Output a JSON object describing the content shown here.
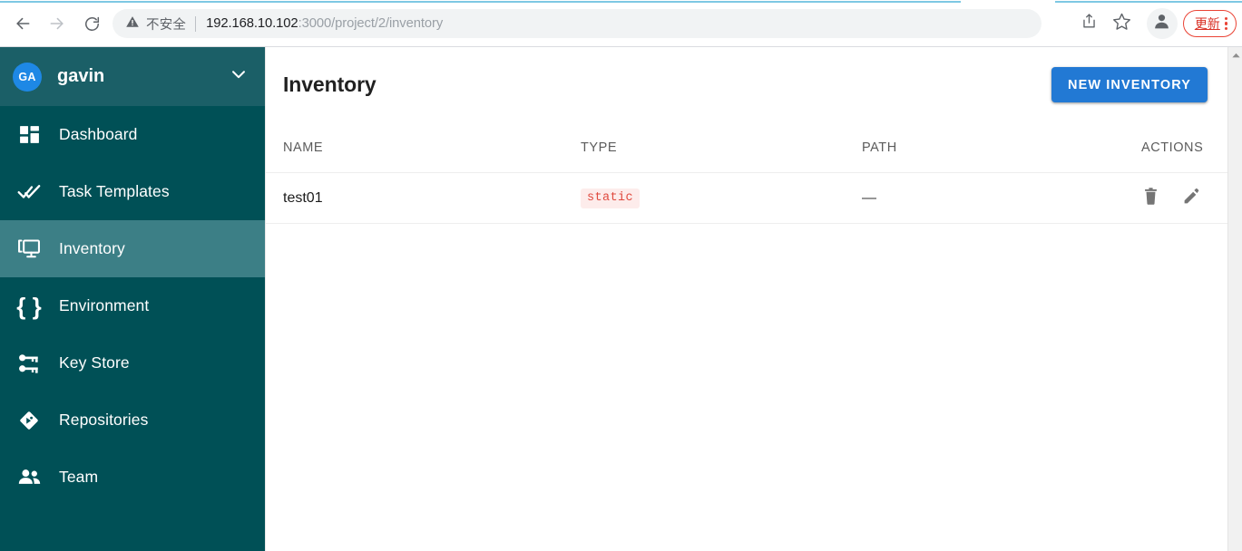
{
  "browser": {
    "nav": {
      "back_icon": "arrow-left-icon",
      "forward_icon": "arrow-right-icon",
      "reload_icon": "reload-icon"
    },
    "omnibox": {
      "security_icon": "warning-triangle-icon",
      "security_label": "不安全",
      "url_host": "192.168.10.102",
      "url_rest": ":3000/project/2/inventory",
      "url_full": "192.168.10.102:3000/project/2/inventory"
    },
    "toolbar": {
      "share_icon": "share-icon",
      "bookmark_icon": "star-icon",
      "profile_icon": "person-avatar-icon",
      "update_label": "更新",
      "menu_icon": "three-dot-menu-icon"
    }
  },
  "sidebar": {
    "avatar_initials": "GA",
    "username": "gavin",
    "chevron_icon": "chevron-down-icon",
    "items": [
      {
        "label": "Dashboard",
        "icon": "dashboard-grid-icon",
        "active": false
      },
      {
        "label": "Task Templates",
        "icon": "double-check-icon",
        "active": false
      },
      {
        "label": "Inventory",
        "icon": "monitor-icon",
        "active": true
      },
      {
        "label": "Environment",
        "icon": "curly-braces-icon",
        "active": false
      },
      {
        "label": "Key Store",
        "icon": "keys-icon",
        "active": false
      },
      {
        "label": "Repositories",
        "icon": "git-diamond-icon",
        "active": false
      },
      {
        "label": "Team",
        "icon": "people-icon",
        "active": false
      }
    ]
  },
  "main": {
    "page_title": "Inventory",
    "new_button_label": "NEW INVENTORY",
    "table": {
      "headers": [
        "NAME",
        "TYPE",
        "PATH",
        "ACTIONS"
      ],
      "rows": [
        {
          "name": "test01",
          "type": "static",
          "path": "—",
          "actions": [
            "delete-icon",
            "edit-icon"
          ]
        }
      ]
    }
  },
  "colors": {
    "sidebar_bg": "#005056",
    "sidebar_header_bg": "#1b5f67",
    "sidebar_active_bg": "#3c7f86",
    "primary_button": "#2279d4",
    "avatar_blue": "#1e88e5",
    "badge_text": "#e04a3f",
    "badge_bg": "#fdeceb",
    "update_red": "#ea4335"
  }
}
